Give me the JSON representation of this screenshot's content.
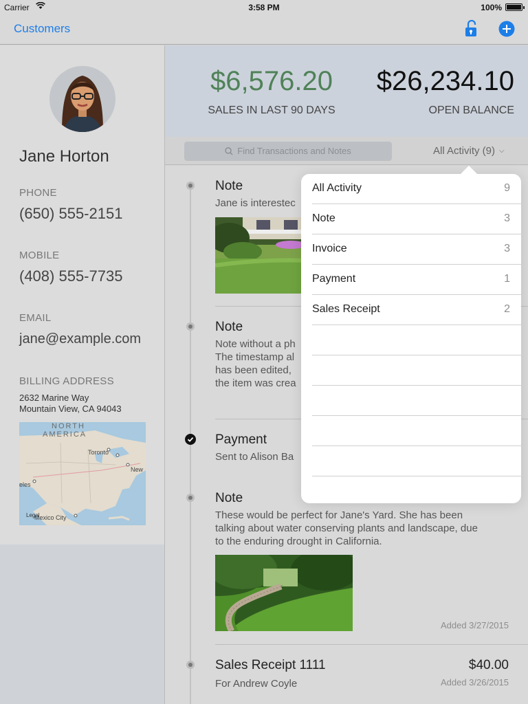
{
  "status_bar": {
    "carrier": "Carrier",
    "time": "3:58 PM",
    "battery": "100%"
  },
  "nav": {
    "back_label": "Customers",
    "icons": [
      "unlock-icon",
      "add-circle-icon"
    ],
    "accent": "#1d7ee8"
  },
  "customer": {
    "name": "Jane Horton",
    "phone_label": "PHONE",
    "phone": "(650) 555-2151",
    "mobile_label": "MOBILE",
    "mobile": "(408) 555-7735",
    "email_label": "EMAIL",
    "email": "jane@example.com",
    "address_label": "BILLING ADDRESS",
    "address_line1": "2632 Marine Way",
    "address_line2": "Mountain View, CA 94043",
    "map": {
      "region_line1": "NORTH",
      "region_line2": "AMERICA",
      "city_toronto": "Toronto",
      "city_new": "New",
      "city_eles": "eles",
      "city_mexico": "Mexico City",
      "legal": "Legal"
    }
  },
  "summary": {
    "sales_amount": "$6,576.20",
    "sales_label": "SALES IN LAST 90 DAYS",
    "sales_color": "#4f8257",
    "balance_amount": "$26,234.10",
    "balance_label": "OPEN BALANCE"
  },
  "toolbar": {
    "search_placeholder": "Find Transactions and Notes",
    "filter_label": "All Activity (9)"
  },
  "timeline": [
    {
      "type": "Note",
      "title": "Note",
      "text": "Jane is interestec"
    },
    {
      "type": "Note",
      "title": "Note",
      "lines": [
        "Note without a ph",
        "The timestamp al",
        "has been edited,",
        "the item was crea"
      ]
    },
    {
      "type": "Payment",
      "title": "Payment",
      "text": "Sent to Alison Ba"
    },
    {
      "type": "Note",
      "title": "Note",
      "lines": [
        "These would be perfect for Jane's Yard. She has been",
        "talking about water conserving plants and landscape, due",
        "to the enduring drought in California."
      ],
      "date": "Added 3/27/2015"
    },
    {
      "type": "Sales Receipt",
      "title": "Sales Receipt 1111",
      "text": "For Andrew Coyle",
      "amount": "$40.00",
      "date": "Added 3/26/2015"
    }
  ],
  "filter_menu": [
    {
      "label": "All Activity",
      "count": "9"
    },
    {
      "label": "Note",
      "count": "3"
    },
    {
      "label": "Invoice",
      "count": "3"
    },
    {
      "label": "Payment",
      "count": "1"
    },
    {
      "label": "Sales Receipt",
      "count": "2"
    }
  ]
}
